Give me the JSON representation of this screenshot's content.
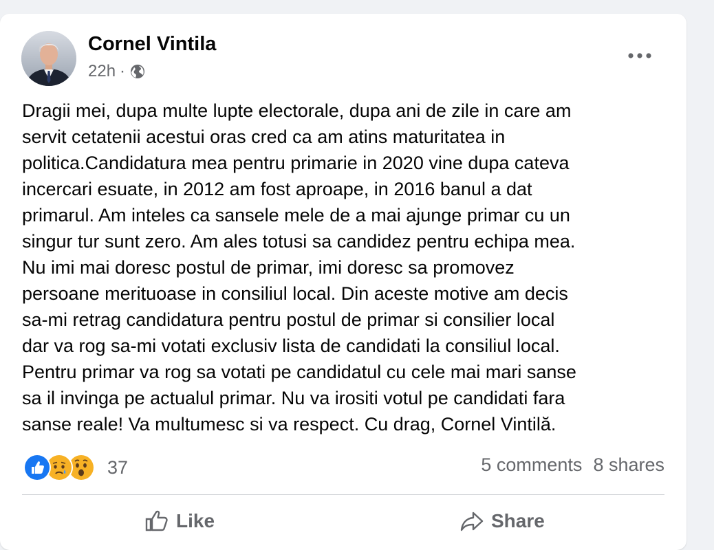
{
  "post": {
    "author": "Cornel Vintila",
    "time": "22h",
    "separator": "·",
    "privacy_icon": "globe-icon",
    "text": "Dragii mei, dupa multe lupte electorale, dupa  ani de zile in care am\nservit cetatenii acestui oras cred ca am atins maturitatea in\npolitica.Candidatura mea pentru primarie in 2020 vine dupa cateva\nincercari esuate, in 2012 am fost aproape, in 2016 banul a dat\nprimarul. Am inteles ca sansele mele de a mai  ajunge primar cu un\nsingur tur sunt zero. Am ales totusi sa candidez pentru echipa mea.\nNu imi mai doresc postul de primar, imi doresc sa promovez\npersoane  merituoase in consiliul  local. Din aceste motive am decis\nsa-mi retrag candidatura pentru postul de primar si consilier local\ndar va rog sa-mi votati exclusiv lista de candidati la consiliul local.\nPentru primar va rog sa votati pe candidatul cu cele mai mari sanse\nsa il invinga pe actualul primar.  Nu va irositi votul pe candidati fara\nsanse reale!  Va multumesc si va respect. Cu drag, Cornel Vintilă."
  },
  "reactions": {
    "icons": [
      "like-reaction-icon",
      "sad-reaction-icon",
      "wow-reaction-icon"
    ],
    "count": "37",
    "comments": "5 comments",
    "shares": "8 shares"
  },
  "actions": {
    "like_label": "Like",
    "share_label": "Share"
  },
  "colors": {
    "like_blue": "#1877f2",
    "reaction_yellow": "#f7b125",
    "secondary_text": "#65676b"
  }
}
